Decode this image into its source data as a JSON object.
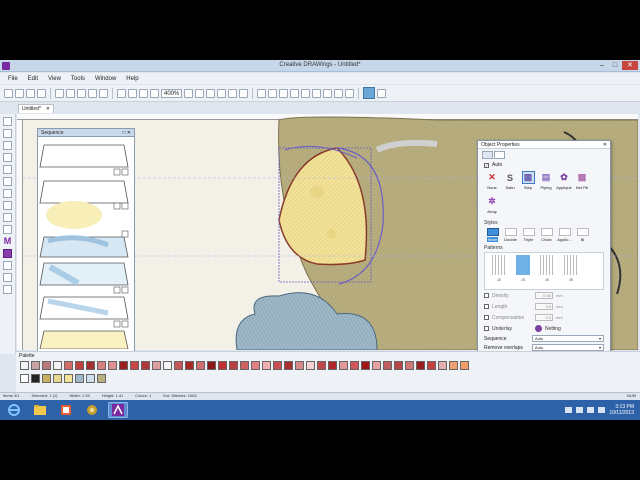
{
  "window": {
    "title": "Creative DRAWings - Untitled*",
    "controls": {
      "minimize": "–",
      "maximize": "□",
      "close": "✕"
    }
  },
  "menu": [
    "File",
    "Edit",
    "View",
    "Tools",
    "Window",
    "Help"
  ],
  "toolbar": {
    "zoom": "400%"
  },
  "document_tab": {
    "name": "Untitled*",
    "close": "✕"
  },
  "sequence": {
    "title": "Sequence",
    "controls": "□ ✕"
  },
  "object_properties": {
    "title": "Object Properties",
    "close": "✕",
    "auto_label": "Auto",
    "types": [
      {
        "label": "None",
        "icon": "✕"
      },
      {
        "label": "Satin",
        "icon": "S"
      },
      {
        "label": "Step",
        "icon": "▦"
      },
      {
        "label": "Piping",
        "icon": "▤"
      },
      {
        "label": "Appliqué",
        "icon": "✿"
      },
      {
        "label": "Net Fill",
        "icon": "▩"
      },
      {
        "label": "Array",
        "icon": "✲"
      }
    ],
    "styles_label": "Styles",
    "styles": [
      "None",
      "Double",
      "Triple",
      "Chain",
      "Applio...",
      "Bl"
    ],
    "patterns_label": "Patterns",
    "patterns": [
      "/2",
      "/3",
      "/4",
      "/5"
    ],
    "fields": [
      {
        "name": "Density",
        "value": "0.40",
        "unit": "mm"
      },
      {
        "name": "Length",
        "value": "3.0",
        "unit": "mm"
      },
      {
        "name": "Compensation",
        "value": "0.3",
        "unit": "mm"
      }
    ],
    "underlay_label": "Underlay",
    "underlay_value": "Netting",
    "sequence_label": "Sequence",
    "sequence_value": "Auto",
    "remove_overlaps_label": "Remove overlaps",
    "remove_overlaps_value": "Auto"
  },
  "palette": {
    "title": "Palette"
  },
  "status": {
    "items": "Items 3/1",
    "selected": "Selected: 1 (1)",
    "width": "Width: 1.05",
    "height": "Height: 1.41",
    "colors": "Colors: 1",
    "stitches": "Est. Stitches: 1063",
    "lang": "NUM"
  },
  "taskbar": {
    "time": "3:13 PM",
    "date": "10/11/2013"
  },
  "colors": {
    "accent": "#3c7bc1",
    "fabric_tan": "#b8ae80",
    "cheese_yellow": "#f3e39a",
    "cloud_blue": "#9eb8c8",
    "selection": "#6b5fc6"
  }
}
